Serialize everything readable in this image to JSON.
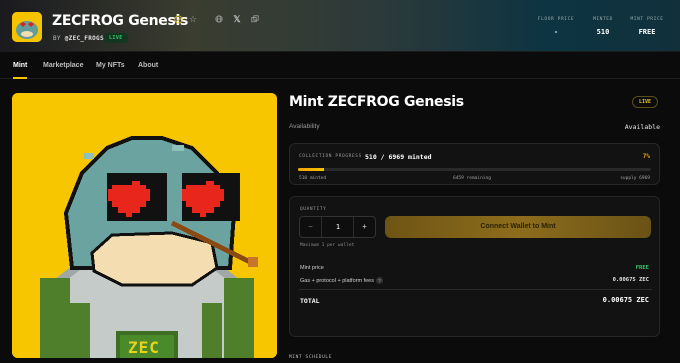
{
  "header": {
    "title": "ZECFROG Genesis",
    "by_prefix": "BY",
    "creator": "@ZEC_FROGS",
    "live_label": "LIVE",
    "icons": [
      "verified-icon",
      "star-icon",
      "globe-icon",
      "x-icon",
      "copy-icon"
    ],
    "stats": [
      {
        "label": "FLOOR PRICE",
        "value": "-"
      },
      {
        "label": "MINTED",
        "value": "510"
      },
      {
        "label": "MINT PRICE",
        "value": "FREE"
      }
    ]
  },
  "nav": {
    "items": [
      "Mint",
      "Marketplace",
      "My NFTs",
      "About"
    ],
    "active": "Mint"
  },
  "mint": {
    "title": "Mint ZECFROG Genesis",
    "live_label": "LIVE",
    "availability_label": "Availability",
    "availability_value": "Available",
    "progress": {
      "label": "COLLECTION PROGRESS",
      "value": "510 / 6969 minted",
      "percent_text": "7%",
      "fill_fraction": 0.073,
      "minted": "510 minted",
      "remaining": "6459 remaining",
      "supply": "supply 6969"
    },
    "quantity": {
      "label": "QUANTITY",
      "minus": "−",
      "plus": "+",
      "value": "1",
      "note": "Maximum 1 per wallet"
    },
    "connect_label": "Connect Wallet to Mint",
    "lines": [
      {
        "label": "Mint price",
        "value": "FREE"
      },
      {
        "label": "Gas + protocol + platform fees",
        "value": "0.00675 ZEC"
      }
    ],
    "fee_info": "?",
    "total_label": "TOTAL",
    "total_value": "0.00675 ZEC",
    "schedule_label": "MINT SCHEDULE"
  },
  "art": {
    "badge_text": "ZEC"
  },
  "colors": {
    "accent": "#f5c400",
    "live_green": "#34c76a",
    "percent_orange": "#f0a020"
  }
}
